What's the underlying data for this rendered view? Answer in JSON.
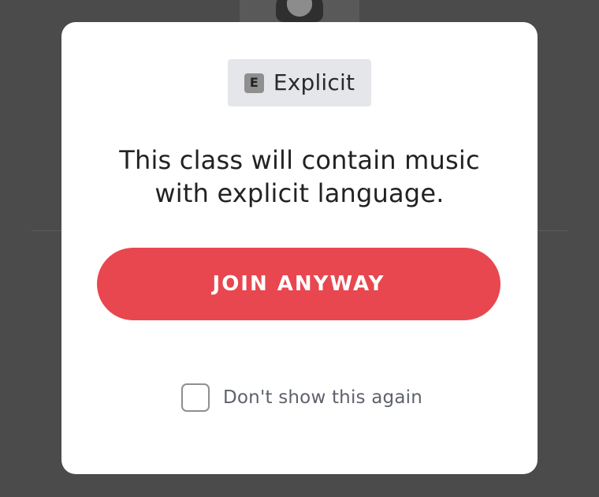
{
  "explicit_badge": {
    "icon_letter": "E",
    "label": "Explicit"
  },
  "message": {
    "line1": "This class will contain music",
    "line2": "with explicit language."
  },
  "actions": {
    "join_anyway": "JOIN ANYWAY"
  },
  "preferences": {
    "dont_show_again_label": "Don't show this again",
    "dont_show_again_checked": false
  },
  "colors": {
    "backdrop": "#4b4b4b",
    "modal_background": "#ffffff",
    "badge_background": "#e5e6ea",
    "join_button": "#e8474f",
    "checkbox_border": "#8f8f8f",
    "secondary_text": "#5e626b"
  }
}
